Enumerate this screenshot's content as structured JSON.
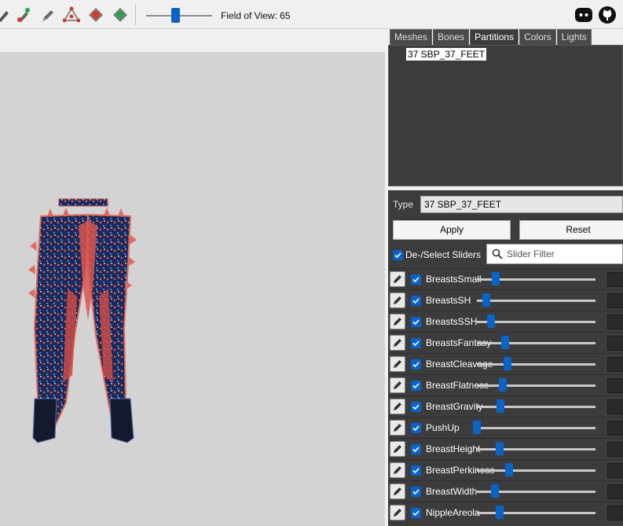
{
  "toolbar": {
    "icons": [
      "brush-icon",
      "color-brush-icon",
      "pen-icon",
      "move-transform-icon",
      "red-diamond-tool-icon",
      "green-diamond-tool-icon"
    ],
    "fov_label": "Field of View: 65",
    "fov_value": 65,
    "social": [
      "discord-icon",
      "github-icon"
    ]
  },
  "tabs": [
    "Meshes",
    "Bones",
    "Partitions",
    "Colors",
    "Lights"
  ],
  "active_tab": "Partitions",
  "partitions": {
    "selected": "37 SBP_37_FEET"
  },
  "type": {
    "label": "Type",
    "value": "37 SBP_37_FEET"
  },
  "buttons": {
    "apply": "Apply",
    "reset": "Reset"
  },
  "deselect": {
    "label": "De-/Select Sliders",
    "checked": true
  },
  "filter": {
    "placeholder": "Slider Filter"
  },
  "sliders": [
    {
      "name": "BreastsSmall",
      "value": 0.08
    },
    {
      "name": "BreastsSH",
      "value": 0.0
    },
    {
      "name": "BreastsSSH",
      "value": 0.04
    },
    {
      "name": "BreastsFantasy",
      "value": 0.16
    },
    {
      "name": "BreastCleavage",
      "value": 0.18
    },
    {
      "name": "BreastFlatness",
      "value": 0.14
    },
    {
      "name": "BreastGravity",
      "value": 0.12
    },
    {
      "name": "PushUp",
      "value": -0.08
    },
    {
      "name": "BreastHeight",
      "value": 0.11
    },
    {
      "name": "BreastPerkiness",
      "value": 0.19
    },
    {
      "name": "BreastWidth",
      "value": 0.07
    },
    {
      "name": "NippleAreola",
      "value": 0.11
    }
  ],
  "colors": {
    "accent": "#0a64c8",
    "panel": "#3c3c3c",
    "viewport": "#d3d3d3"
  }
}
